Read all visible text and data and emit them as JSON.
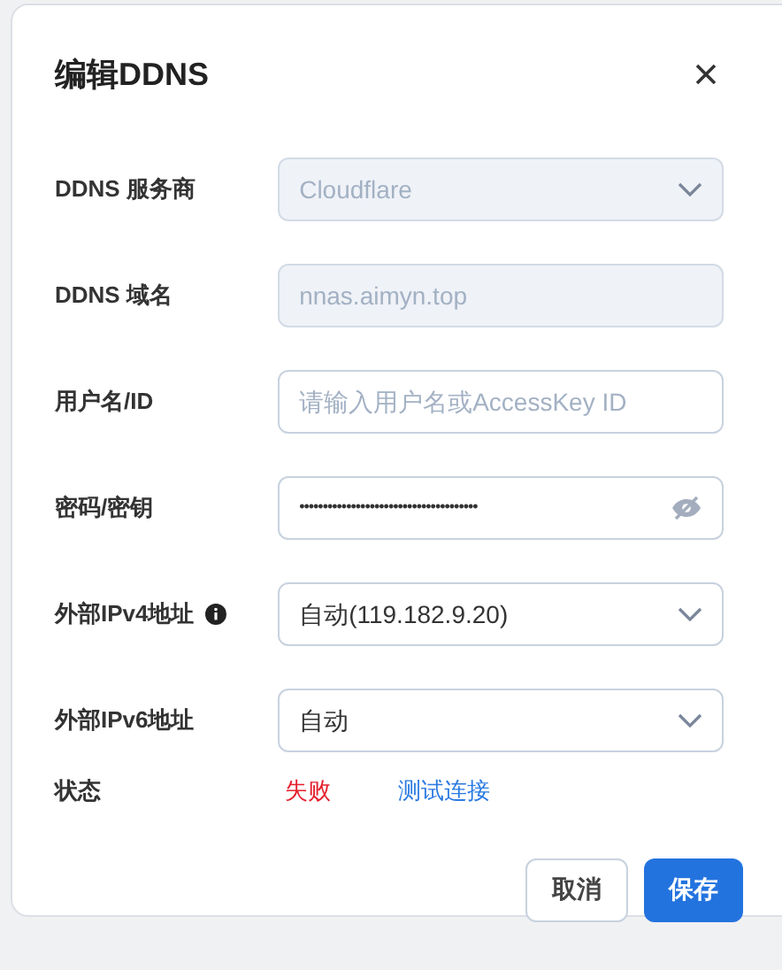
{
  "dialog": {
    "title": "编辑DDNS",
    "fields": [
      {
        "label": "DDNS 服务商",
        "kind": "select",
        "value": "Cloudflare",
        "disabled": true
      },
      {
        "label": "DDNS 域名",
        "kind": "text",
        "value": "nnas.aimyn.top",
        "disabled": true
      },
      {
        "label": "用户名/ID",
        "kind": "text",
        "placeholder": "请输入用户名或AccessKey ID",
        "disabled": false
      },
      {
        "label": "密码/密钥",
        "kind": "password",
        "value": "••••••••••••••••••••••••••••••••••••••",
        "disabled": false
      },
      {
        "label": "外部IPv4地址",
        "kind": "select",
        "value": "自动(119.182.9.20)",
        "disabled": false,
        "info": true
      },
      {
        "label": "外部IPv6地址",
        "kind": "select",
        "value": "自动",
        "disabled": false
      }
    ],
    "status": {
      "label": "状态",
      "value": "失败",
      "color": "#e5202e",
      "link": "测试连接"
    },
    "buttons": [
      {
        "label": "取消",
        "kind": "secondary"
      },
      {
        "label": "保存",
        "kind": "primary"
      }
    ]
  }
}
